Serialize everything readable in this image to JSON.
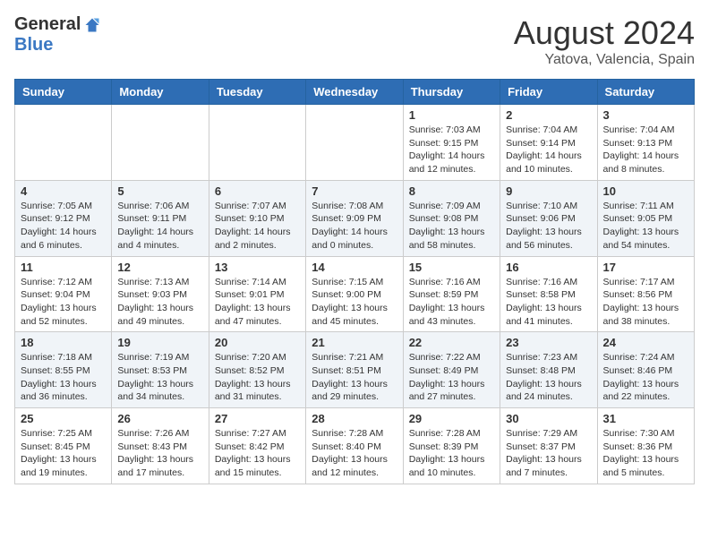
{
  "logo": {
    "general": "General",
    "blue": "Blue"
  },
  "header": {
    "month": "August 2024",
    "location": "Yatova, Valencia, Spain"
  },
  "days_of_week": [
    "Sunday",
    "Monday",
    "Tuesday",
    "Wednesday",
    "Thursday",
    "Friday",
    "Saturday"
  ],
  "weeks": [
    [
      {
        "day": "",
        "sunrise": "",
        "sunset": "",
        "daylight": ""
      },
      {
        "day": "",
        "sunrise": "",
        "sunset": "",
        "daylight": ""
      },
      {
        "day": "",
        "sunrise": "",
        "sunset": "",
        "daylight": ""
      },
      {
        "day": "",
        "sunrise": "",
        "sunset": "",
        "daylight": ""
      },
      {
        "day": "1",
        "sunrise": "Sunrise: 7:03 AM",
        "sunset": "Sunset: 9:15 PM",
        "daylight": "Daylight: 14 hours and 12 minutes."
      },
      {
        "day": "2",
        "sunrise": "Sunrise: 7:04 AM",
        "sunset": "Sunset: 9:14 PM",
        "daylight": "Daylight: 14 hours and 10 minutes."
      },
      {
        "day": "3",
        "sunrise": "Sunrise: 7:04 AM",
        "sunset": "Sunset: 9:13 PM",
        "daylight": "Daylight: 14 hours and 8 minutes."
      }
    ],
    [
      {
        "day": "4",
        "sunrise": "Sunrise: 7:05 AM",
        "sunset": "Sunset: 9:12 PM",
        "daylight": "Daylight: 14 hours and 6 minutes."
      },
      {
        "day": "5",
        "sunrise": "Sunrise: 7:06 AM",
        "sunset": "Sunset: 9:11 PM",
        "daylight": "Daylight: 14 hours and 4 minutes."
      },
      {
        "day": "6",
        "sunrise": "Sunrise: 7:07 AM",
        "sunset": "Sunset: 9:10 PM",
        "daylight": "Daylight: 14 hours and 2 minutes."
      },
      {
        "day": "7",
        "sunrise": "Sunrise: 7:08 AM",
        "sunset": "Sunset: 9:09 PM",
        "daylight": "Daylight: 14 hours and 0 minutes."
      },
      {
        "day": "8",
        "sunrise": "Sunrise: 7:09 AM",
        "sunset": "Sunset: 9:08 PM",
        "daylight": "Daylight: 13 hours and 58 minutes."
      },
      {
        "day": "9",
        "sunrise": "Sunrise: 7:10 AM",
        "sunset": "Sunset: 9:06 PM",
        "daylight": "Daylight: 13 hours and 56 minutes."
      },
      {
        "day": "10",
        "sunrise": "Sunrise: 7:11 AM",
        "sunset": "Sunset: 9:05 PM",
        "daylight": "Daylight: 13 hours and 54 minutes."
      }
    ],
    [
      {
        "day": "11",
        "sunrise": "Sunrise: 7:12 AM",
        "sunset": "Sunset: 9:04 PM",
        "daylight": "Daylight: 13 hours and 52 minutes."
      },
      {
        "day": "12",
        "sunrise": "Sunrise: 7:13 AM",
        "sunset": "Sunset: 9:03 PM",
        "daylight": "Daylight: 13 hours and 49 minutes."
      },
      {
        "day": "13",
        "sunrise": "Sunrise: 7:14 AM",
        "sunset": "Sunset: 9:01 PM",
        "daylight": "Daylight: 13 hours and 47 minutes."
      },
      {
        "day": "14",
        "sunrise": "Sunrise: 7:15 AM",
        "sunset": "Sunset: 9:00 PM",
        "daylight": "Daylight: 13 hours and 45 minutes."
      },
      {
        "day": "15",
        "sunrise": "Sunrise: 7:16 AM",
        "sunset": "Sunset: 8:59 PM",
        "daylight": "Daylight: 13 hours and 43 minutes."
      },
      {
        "day": "16",
        "sunrise": "Sunrise: 7:16 AM",
        "sunset": "Sunset: 8:58 PM",
        "daylight": "Daylight: 13 hours and 41 minutes."
      },
      {
        "day": "17",
        "sunrise": "Sunrise: 7:17 AM",
        "sunset": "Sunset: 8:56 PM",
        "daylight": "Daylight: 13 hours and 38 minutes."
      }
    ],
    [
      {
        "day": "18",
        "sunrise": "Sunrise: 7:18 AM",
        "sunset": "Sunset: 8:55 PM",
        "daylight": "Daylight: 13 hours and 36 minutes."
      },
      {
        "day": "19",
        "sunrise": "Sunrise: 7:19 AM",
        "sunset": "Sunset: 8:53 PM",
        "daylight": "Daylight: 13 hours and 34 minutes."
      },
      {
        "day": "20",
        "sunrise": "Sunrise: 7:20 AM",
        "sunset": "Sunset: 8:52 PM",
        "daylight": "Daylight: 13 hours and 31 minutes."
      },
      {
        "day": "21",
        "sunrise": "Sunrise: 7:21 AM",
        "sunset": "Sunset: 8:51 PM",
        "daylight": "Daylight: 13 hours and 29 minutes."
      },
      {
        "day": "22",
        "sunrise": "Sunrise: 7:22 AM",
        "sunset": "Sunset: 8:49 PM",
        "daylight": "Daylight: 13 hours and 27 minutes."
      },
      {
        "day": "23",
        "sunrise": "Sunrise: 7:23 AM",
        "sunset": "Sunset: 8:48 PM",
        "daylight": "Daylight: 13 hours and 24 minutes."
      },
      {
        "day": "24",
        "sunrise": "Sunrise: 7:24 AM",
        "sunset": "Sunset: 8:46 PM",
        "daylight": "Daylight: 13 hours and 22 minutes."
      }
    ],
    [
      {
        "day": "25",
        "sunrise": "Sunrise: 7:25 AM",
        "sunset": "Sunset: 8:45 PM",
        "daylight": "Daylight: 13 hours and 19 minutes."
      },
      {
        "day": "26",
        "sunrise": "Sunrise: 7:26 AM",
        "sunset": "Sunset: 8:43 PM",
        "daylight": "Daylight: 13 hours and 17 minutes."
      },
      {
        "day": "27",
        "sunrise": "Sunrise: 7:27 AM",
        "sunset": "Sunset: 8:42 PM",
        "daylight": "Daylight: 13 hours and 15 minutes."
      },
      {
        "day": "28",
        "sunrise": "Sunrise: 7:28 AM",
        "sunset": "Sunset: 8:40 PM",
        "daylight": "Daylight: 13 hours and 12 minutes."
      },
      {
        "day": "29",
        "sunrise": "Sunrise: 7:28 AM",
        "sunset": "Sunset: 8:39 PM",
        "daylight": "Daylight: 13 hours and 10 minutes."
      },
      {
        "day": "30",
        "sunrise": "Sunrise: 7:29 AM",
        "sunset": "Sunset: 8:37 PM",
        "daylight": "Daylight: 13 hours and 7 minutes."
      },
      {
        "day": "31",
        "sunrise": "Sunrise: 7:30 AM",
        "sunset": "Sunset: 8:36 PM",
        "daylight": "Daylight: 13 hours and 5 minutes."
      }
    ]
  ]
}
